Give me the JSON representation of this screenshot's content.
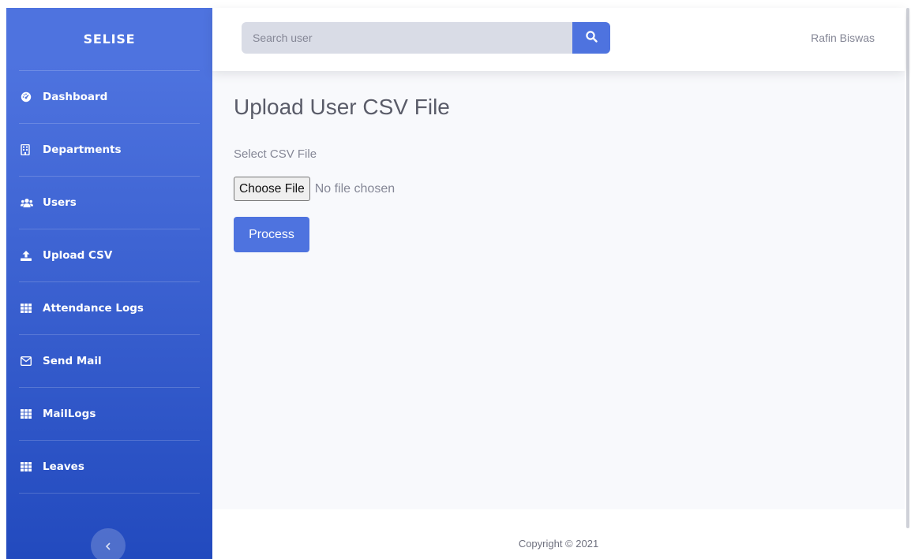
{
  "sidebar": {
    "brand": "SELISE",
    "items": [
      {
        "label": "Dashboard",
        "icon": "dashboard-icon"
      },
      {
        "label": "Departments",
        "icon": "building-icon"
      },
      {
        "label": "Users",
        "icon": "users-icon"
      },
      {
        "label": "Upload CSV",
        "icon": "upload-icon"
      },
      {
        "label": "Attendance Logs",
        "icon": "table-icon"
      },
      {
        "label": "Send Mail",
        "icon": "envelope-icon"
      },
      {
        "label": "MailLogs",
        "icon": "table-icon"
      },
      {
        "label": "Leaves",
        "icon": "table-icon"
      }
    ],
    "toggle_icon": "chevron-left-icon"
  },
  "topbar": {
    "search_placeholder": "Search user",
    "search_icon": "search-icon",
    "user_name": "Rafin Biswas"
  },
  "main": {
    "title": "Upload User CSV File",
    "field_label": "Select CSV File",
    "choose_file_label": "Choose File",
    "no_file_text": "No file chosen",
    "process_label": "Process"
  },
  "footer": {
    "copyright": "Copyright © 2021"
  },
  "colors": {
    "primary": "#4e73df",
    "sidebar_end": "#224abe",
    "content_bg": "#f8f9fc"
  }
}
